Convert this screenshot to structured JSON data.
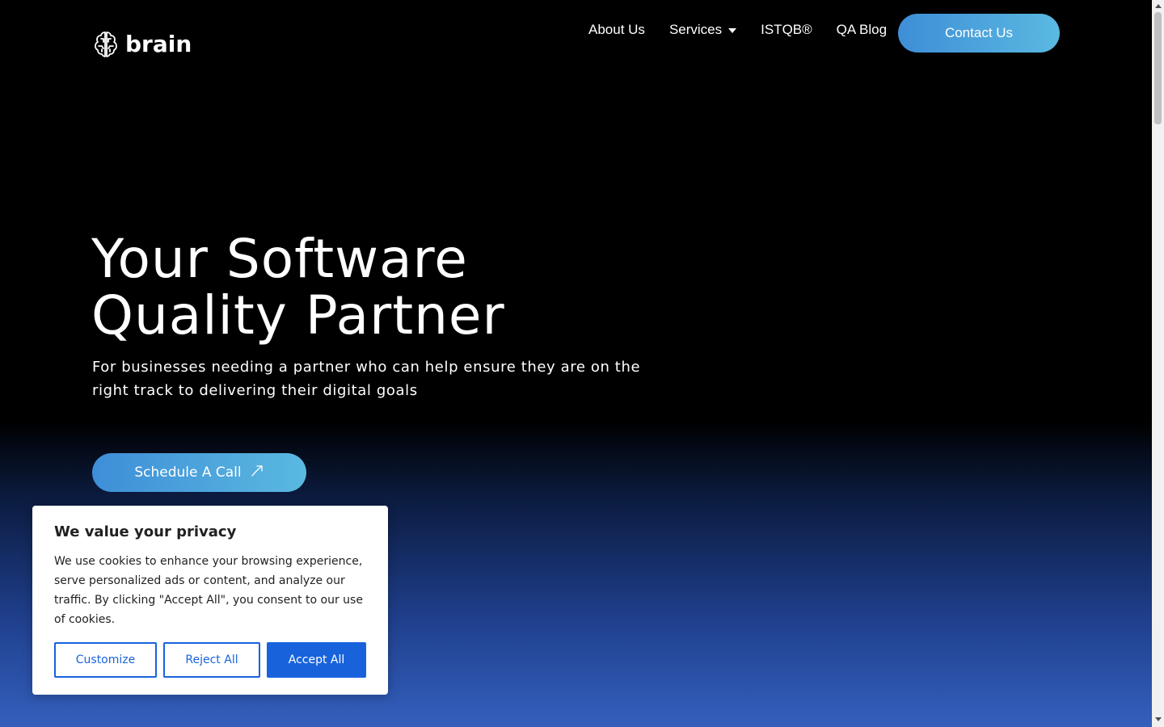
{
  "header": {
    "logo_text": "brain",
    "nav": [
      {
        "label": "About Us"
      },
      {
        "label": "Services"
      },
      {
        "label": "ISTQB®"
      },
      {
        "label": "QA Blog"
      }
    ],
    "contact_label": "Contact Us"
  },
  "hero": {
    "title_line1": "Your Software",
    "title_line2": "Quality Partner",
    "subtitle": "For businesses needing a partner who can help ensure they are on the right track to delivering their digital goals",
    "cta_label": "Schedule A Call"
  },
  "cookie": {
    "title": "We value your privacy",
    "text": "We use cookies to enhance your browsing experience, serve personalized ads or content, and analyze our traffic. By clicking \"Accept All\", you consent to our use of cookies.",
    "customize_label": "Customize",
    "reject_label": "Reject All",
    "accept_label": "Accept All"
  },
  "colors": {
    "accent_gradient_start": "#3e8ed7",
    "accent_gradient_end": "#5ab9e1",
    "cookie_primary": "#1863dc"
  },
  "icons": {
    "logo": "brain-icon",
    "services_caret": "chevron-down-icon",
    "cta_arrow": "arrow-up-right-icon"
  }
}
